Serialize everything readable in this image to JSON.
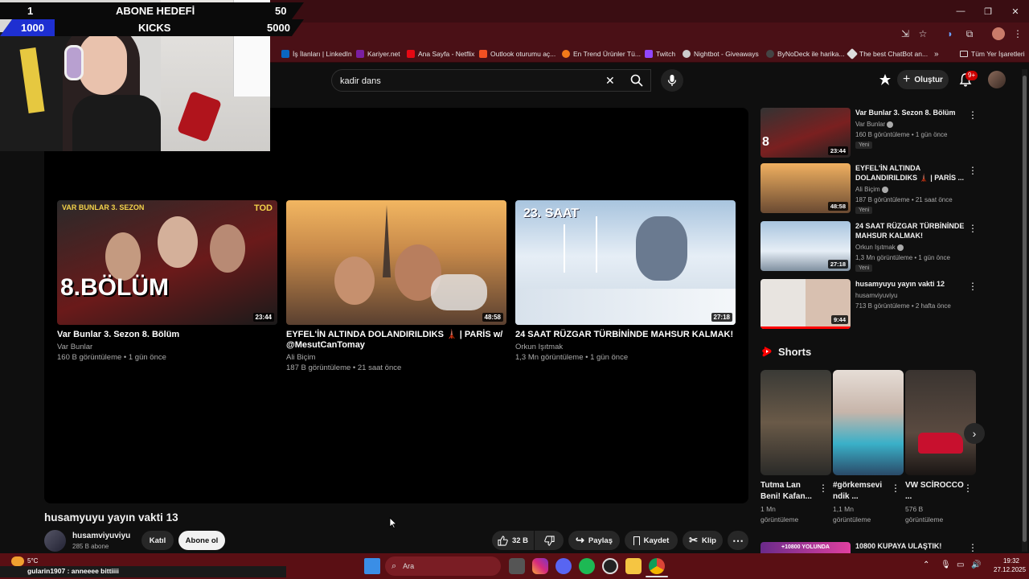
{
  "hud": {
    "current_subs": "1",
    "subs_label": "ABONE HEDEFİ",
    "subs_goal": "50",
    "current_kicks": "1000",
    "kicks_label": "KICKS",
    "kicks_goal": "5000"
  },
  "bookmarks": [
    {
      "label": "İş İlanları | LinkedIn",
      "color": "#0a66c2"
    },
    {
      "label": "Kariyer.net",
      "color": "#7a1fa2"
    },
    {
      "label": "Ana Sayfa - Netflix",
      "color": "#e50914"
    },
    {
      "label": "Outlook oturumu aç...",
      "color": "#f25022"
    },
    {
      "label": "En Trend Ürünler Tü...",
      "color": "#f27a1a"
    },
    {
      "label": "Twitch",
      "color": "#9146ff"
    },
    {
      "label": "Nightbot - Giveaways",
      "color": "#cccccc"
    },
    {
      "label": "ByNoDeck ile harika...",
      "color": "#444444"
    },
    {
      "label": "The best ChatBot an...",
      "color": "#dddddd"
    },
    {
      "label": "»",
      "color": ""
    },
    {
      "label": "Tüm Yer İşaretleri",
      "color": ""
    }
  ],
  "header": {
    "search_value": "kadir dans",
    "create_label": "Oluştur",
    "notif_count": "9+"
  },
  "end_screen": [
    {
      "title": "Var Bunlar 3. Sezon 8. Bölüm",
      "channel": "Var Bunlar",
      "meta": "160 B görüntüleme • 1 gün önce",
      "duration": "23:44",
      "overlay": "8.BÖLÜM",
      "top_text": "VAR BUNLAR 3. SEZON",
      "brand": "TOD"
    },
    {
      "title": "EYFEL'İN ALTINDA DOLANDIRILDIKS 🗼 | PARİS w/ @MesutCanTomay",
      "channel": "Ali Biçim",
      "meta": "187 B görüntüleme • 21 saat önce",
      "duration": "48:58",
      "overlay": "",
      "top_text": "",
      "brand": ""
    },
    {
      "title": "24 SAAT RÜZGAR TÜRBİNİNDE MAHSUR KALMAK!",
      "channel": "Orkun Işıtmak",
      "meta": "1,3 Mn görüntüleme • 1 gün önce",
      "duration": "27:18",
      "overlay": "23. SAAT",
      "top_text": "",
      "brand": ""
    }
  ],
  "video": {
    "title": "husamyuyu yayın vakti 13",
    "channel": "husamviyuviyu",
    "subs": "285 B abone",
    "join_label": "Katıl",
    "subscribe_label": "Abone ol",
    "likes": "32 B",
    "share_label": "Paylaş",
    "save_label": "Kaydet",
    "clip_label": "Klip"
  },
  "sidebar": [
    {
      "title": "Var Bunlar 3. Sezon 8. Bölüm",
      "channel": "Var Bunlar",
      "verified": true,
      "meta": "160 B görüntüleme • 1 gün önce",
      "badge": "Yeni",
      "duration": "23:44"
    },
    {
      "title": "EYFEL'İN ALTINDA DOLANDIRILDIKS 🗼 | PARİS ...",
      "channel": "Ali Biçim",
      "verified": true,
      "meta": "187 B görüntüleme • 21 saat önce",
      "badge": "Yeni",
      "duration": "48:58"
    },
    {
      "title": "24 SAAT RÜZGAR TÜRBİNİNDE MAHSUR KALMAK!",
      "channel": "Orkun Işıtmak",
      "verified": true,
      "meta": "1,3 Mn görüntüleme • 1 gün önce",
      "badge": "Yeni",
      "duration": "27:18"
    },
    {
      "title": "husamyuyu yayın vakti 12",
      "channel": "husamviyuviyu",
      "verified": false,
      "meta": "713 B görüntüleme • 2 hafta önce",
      "badge": "",
      "duration": "9:44"
    }
  ],
  "shorts": {
    "heading": "Shorts",
    "items": [
      {
        "title": "Tutma Lan Beni! Kafan...",
        "views": "1 Mn",
        "views_label": "görüntüleme"
      },
      {
        "title": "#görkemsevi ndik ...",
        "views": "1,1 Mn",
        "views_label": "görüntüleme"
      },
      {
        "title": "VW SCİROCCO ...",
        "views": "576 B",
        "views_label": "görüntüleme"
      }
    ]
  },
  "next_item": {
    "title": "10800 KUPAYA ULAŞTIK!",
    "thumb_text": "+10800 YOLUNDA"
  },
  "chat": {
    "message": "gularin1907 : anneeee bittiiii"
  },
  "taskbar": {
    "weather": "5°C",
    "search_placeholder": "Ara",
    "time": "19:32",
    "date": "27.12.2025"
  },
  "colors": {
    "accent_red": "#ff0000",
    "hud_blue": "#1e2fd1",
    "hud_black": "#000000"
  }
}
